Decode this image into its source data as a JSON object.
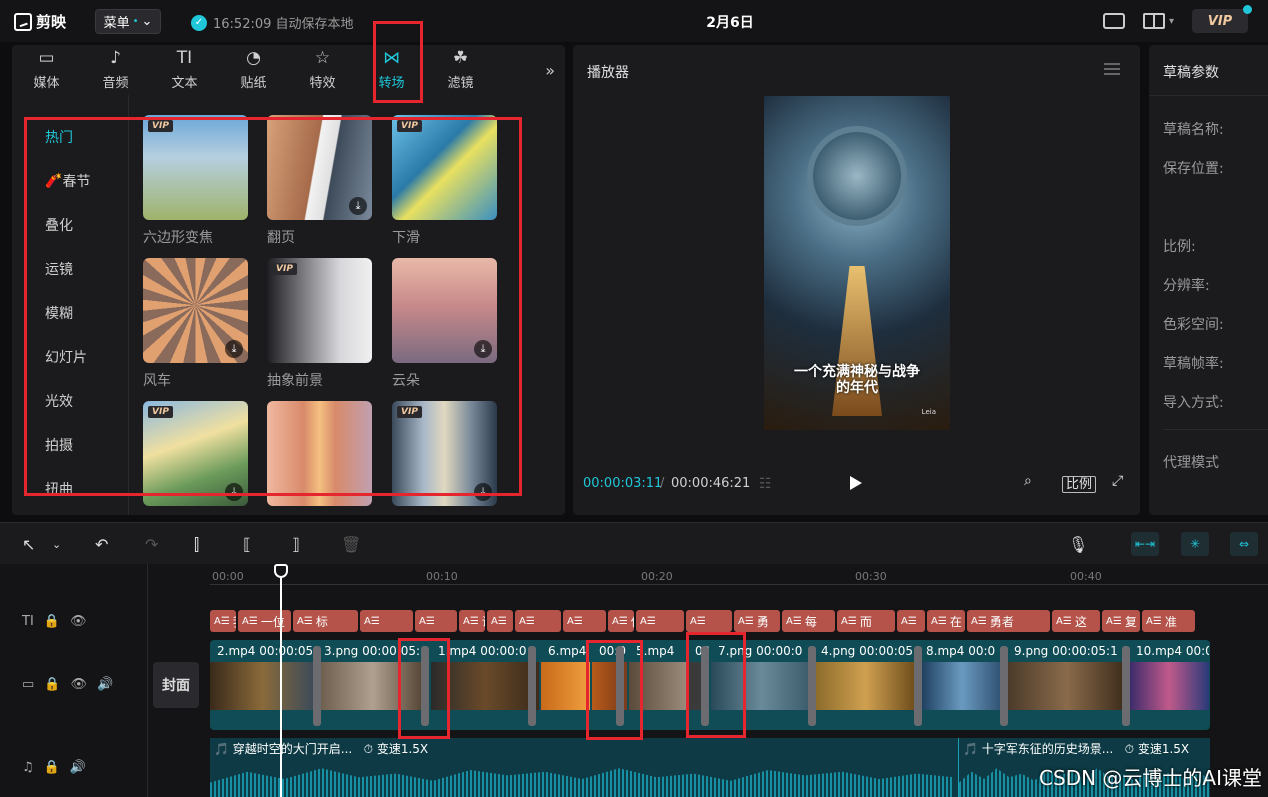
{
  "topbar": {
    "app_name": "剪映",
    "menu_label": "菜单",
    "save_status": "16:52:09 自动保存本地",
    "title": "2月6日",
    "vip_label": "VIP"
  },
  "tabs": [
    {
      "label": "媒体",
      "icon": "media-icon"
    },
    {
      "label": "音频",
      "icon": "audio-icon"
    },
    {
      "label": "文本",
      "icon": "text-icon"
    },
    {
      "label": "贴纸",
      "icon": "sticker-icon"
    },
    {
      "label": "特效",
      "icon": "effects-icon"
    },
    {
      "label": "转场",
      "icon": "transition-icon"
    },
    {
      "label": "滤镜",
      "icon": "filter-icon"
    }
  ],
  "categories": [
    "热门",
    "春节",
    "叠化",
    "运镜",
    "模糊",
    "幻灯片",
    "光效",
    "拍摄",
    "扭曲"
  ],
  "transitions": [
    {
      "label": "六边形变焦",
      "vip": "VIP",
      "download": false
    },
    {
      "label": "翻页",
      "vip": "",
      "download": true
    },
    {
      "label": "下滑",
      "vip": "VIP",
      "download": false
    },
    {
      "label": "风车",
      "vip": "",
      "download": true
    },
    {
      "label": "抽象前景",
      "vip": "VIP",
      "download": false
    },
    {
      "label": "云朵",
      "vip": "",
      "download": true
    },
    {
      "label": "",
      "vip": "VIP",
      "download": true
    },
    {
      "label": "",
      "vip": "",
      "download": false
    },
    {
      "label": "",
      "vip": "VIP",
      "download": true
    }
  ],
  "player": {
    "title": "播放器",
    "subtitle_line1": "一个充满神秘与战争",
    "subtitle_line2": "的年代",
    "video_watermark": "Leia",
    "current_time": "00:00:03:11",
    "separator": "/",
    "total_time": "00:00:46:21",
    "ratio_label": "比例"
  },
  "props": {
    "title": "草稿参数",
    "rows": [
      "草稿名称:",
      "保存位置:",
      "比例:",
      "分辨率:",
      "色彩空间:",
      "草稿帧率:",
      "导入方式:",
      "代理模式"
    ]
  },
  "timeline": {
    "ticks": [
      "00:00",
      "00:10",
      "00:20",
      "00:30",
      "00:40"
    ],
    "cover_label": "封面",
    "subtitle_clips": [
      "我",
      "一位",
      "标",
      "",
      "",
      "说",
      "",
      "",
      "",
      "佑",
      "",
      "",
      "勇",
      "每",
      "而",
      "",
      "在",
      "勇者",
      "这",
      "复",
      "准"
    ],
    "video_clips": [
      {
        "name": "2.mp4",
        "time": "00:00:05"
      },
      {
        "name": "3.png",
        "time": "00:00:05:"
      },
      {
        "name": "1.mp4",
        "time": "00:00:0"
      },
      {
        "name": "6.mp4",
        "time": "00:0"
      },
      {
        "name": "5.mp4",
        "time": "00:0"
      },
      {
        "name": "7.png",
        "time": "00:00:0"
      },
      {
        "name": "4.png",
        "time": "00:00:05"
      },
      {
        "name": "8.mp4",
        "time": "00:0"
      },
      {
        "name": "9.png",
        "time": "00:00:05:1"
      },
      {
        "name": "10.mp4",
        "time": "00:0"
      }
    ],
    "audio_clips": [
      {
        "label": "穿越时空的大门开启...",
        "speed": "变速1.5X"
      },
      {
        "label": "十字军东征的历史场景...",
        "speed": "变速1.5X"
      }
    ]
  },
  "watermark": "CSDN @云博士的AI课堂"
}
